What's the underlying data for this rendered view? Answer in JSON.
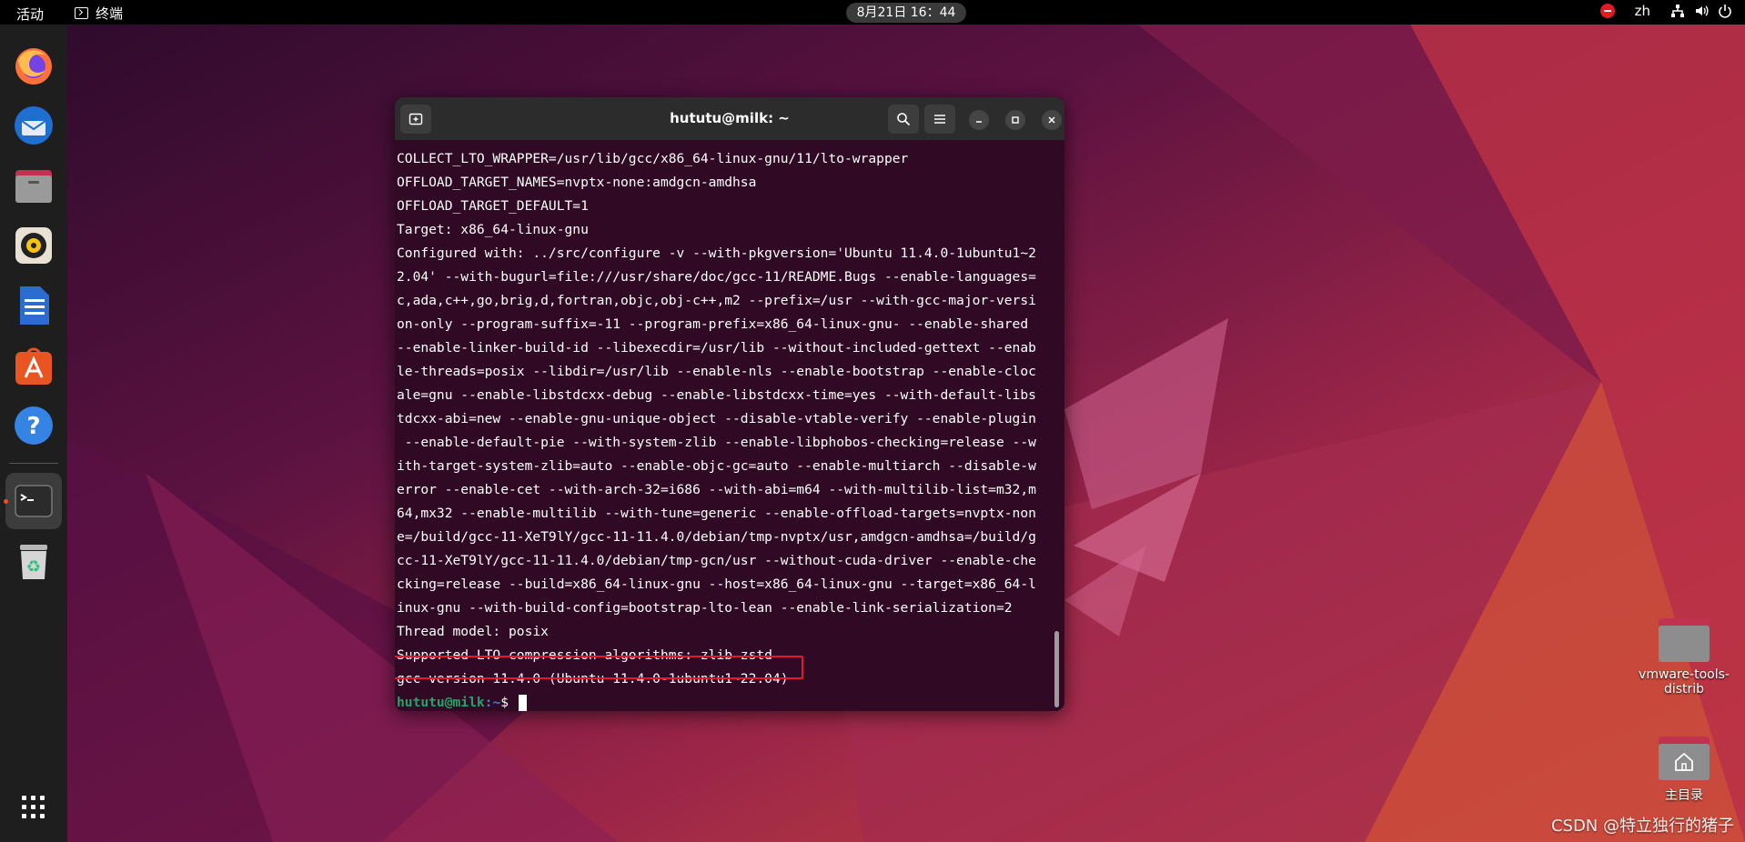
{
  "topbar": {
    "activities": "活动",
    "app_name": "终端",
    "clock": "8月21日  16：44",
    "language": "zh"
  },
  "dock": {
    "items": [
      "firefox-icon",
      "thunderbird-icon",
      "files-icon",
      "rhythmbox-icon",
      "writer-icon",
      "app-center-icon",
      "help-icon",
      "terminal-icon",
      "trash-icon",
      "show-apps-icon"
    ]
  },
  "terminal": {
    "title": "hututu@milk: ~",
    "lines": [
      "COLLECT_LTO_WRAPPER=/usr/lib/gcc/x86_64-linux-gnu/11/lto-wrapper",
      "OFFLOAD_TARGET_NAMES=nvptx-none:amdgcn-amdhsa",
      "OFFLOAD_TARGET_DEFAULT=1",
      "Target: x86_64-linux-gnu",
      "Configured with: ../src/configure -v --with-pkgversion='Ubuntu 11.4.0-1ubuntu1~2",
      "2.04' --with-bugurl=file:///usr/share/doc/gcc-11/README.Bugs --enable-languages=",
      "c,ada,c++,go,brig,d,fortran,objc,obj-c++,m2 --prefix=/usr --with-gcc-major-versi",
      "on-only --program-suffix=-11 --program-prefix=x86_64-linux-gnu- --enable-shared",
      "--enable-linker-build-id --libexecdir=/usr/lib --without-included-gettext --enab",
      "le-threads=posix --libdir=/usr/lib --enable-nls --enable-bootstrap --enable-cloc",
      "ale=gnu --enable-libstdcxx-debug --enable-libstdcxx-time=yes --with-default-libs",
      "tdcxx-abi=new --enable-gnu-unique-object --disable-vtable-verify --enable-plugin",
      " --enable-default-pie --with-system-zlib --enable-libphobos-checking=release --w",
      "ith-target-system-zlib=auto --enable-objc-gc=auto --enable-multiarch --disable-w",
      "error --enable-cet --with-arch-32=i686 --with-abi=m64 --with-multilib-list=m32,m",
      "64,mx32 --enable-multilib --with-tune=generic --enable-offload-targets=nvptx-non",
      "e=/build/gcc-11-XeT9lY/gcc-11-11.4.0/debian/tmp-nvptx/usr,amdgcn-amdhsa=/build/g",
      "cc-11-XeT9lY/gcc-11-11.4.0/debian/tmp-gcn/usr --without-cuda-driver --enable-che",
      "cking=release --build=x86_64-linux-gnu --host=x86_64-linux-gnu --target=x86_64-l",
      "inux-gnu --with-build-config=bootstrap-lto-lean --enable-link-serialization=2",
      "Thread model: posix",
      "Supported LTO compression algorithms: zlib zstd",
      "gcc version 11.4.0 (Ubuntu 11.4.0-1ubuntu1~22.04)"
    ],
    "prompt_user": "hututu@milk",
    "prompt_path": ":~",
    "prompt_symbol": "$"
  },
  "desktop": {
    "items": [
      {
        "label_line1": "vmware-tools-",
        "label_line2": "distrib"
      },
      {
        "label_line1": "主目录",
        "label_line2": ""
      }
    ]
  },
  "watermark": "CSDN @特立独行的猪子",
  "colors": {
    "accent": "#e95420",
    "terminal_bg": "#300a24",
    "highlight": "#e01b24",
    "prompt_user": "#26a269",
    "prompt_path": "#3b7fd8"
  }
}
